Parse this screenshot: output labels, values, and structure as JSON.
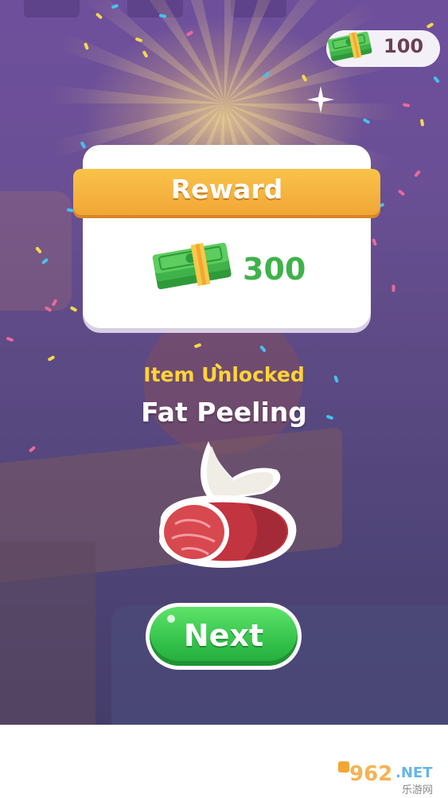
{
  "hud": {
    "coins": "100",
    "coin_icon": "cash-stack-icon"
  },
  "reward": {
    "title": "Reward",
    "amount": "300",
    "icon": "cash-stack-icon"
  },
  "unlock": {
    "label": "Item Unlocked",
    "item_name": "Fat Peeling",
    "item_icon": "meat-with-fat-icon"
  },
  "actions": {
    "next_label": "Next"
  },
  "watermark": {
    "main": "962",
    "suffix": ".NET",
    "sub": "乐游网"
  },
  "colors": {
    "banner": "#f2a636",
    "reward_amount": "#3fb24a",
    "unlock_label": "#ffd43a",
    "next_button": "#33c24a",
    "background": "#6a4f95"
  }
}
